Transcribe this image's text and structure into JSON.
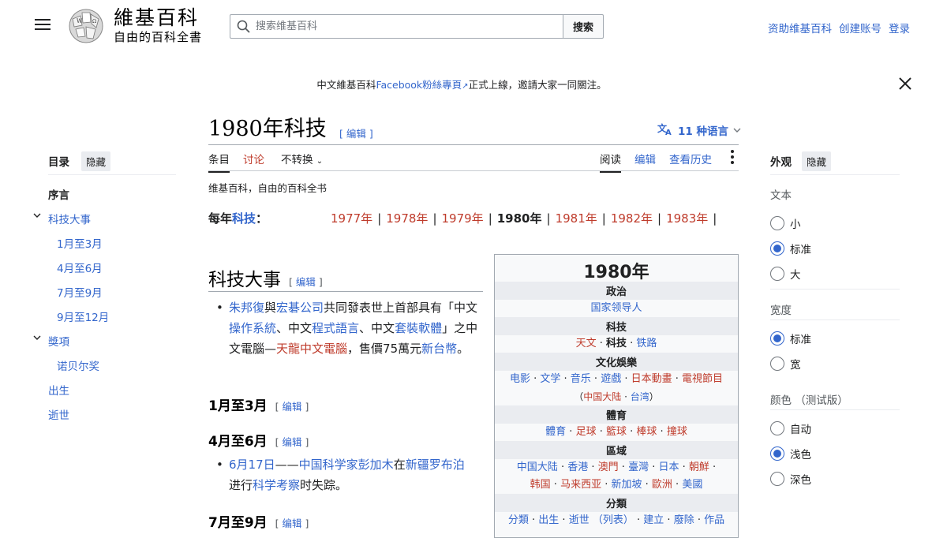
{
  "header": {
    "logo_title": "維基百科",
    "logo_tagline": "自由的百科全書",
    "search_placeholder": "搜索维基百科",
    "search_button": "搜索",
    "user_links": [
      "资助维基百科",
      "创建账号",
      "登录"
    ]
  },
  "banner": {
    "prefix": "中文維基百科",
    "link": "Facebook粉絲專頁",
    "suffix": "正式上線，邀請大家一同關注。"
  },
  "article": {
    "title": "1980年科技",
    "edit_label": "[ 编辑 ]",
    "languages": "11 种语言",
    "tabs_left": [
      "条目",
      "讨论",
      "不转换"
    ],
    "tabs_right": [
      "阅读",
      "编辑",
      "查看历史"
    ],
    "tagline": "维基百科，自由的百科全书",
    "year_label_prefix": "每年",
    "year_label_link": "科技",
    "year_label_suffix": "：",
    "years": [
      "1977年",
      "1978年",
      "1979年",
      "1980年",
      "1981年",
      "1982年",
      "1983年"
    ],
    "section1": {
      "heading": "科技大事",
      "bullet": {
        "p1": "朱邦復",
        "p2": "與",
        "p3": "宏碁公司",
        "p4": "共同發表世上首部具有「中文",
        "p5": "操作系統",
        "p6": "、中文",
        "p7": "程式語言",
        "p8": "、中文",
        "p9": "套裝軟體",
        "p10": "」之中文電腦—",
        "p11": "天龍中文電腦",
        "p12": "，售價75萬元",
        "p13": "新台幣",
        "p14": "。"
      }
    },
    "h3_jan": "1月至3月",
    "h3_apr": "4月至6月",
    "apr_bullet": {
      "p1": "6月17日",
      "p2": "——",
      "p3": "中国",
      "p4": "科学家",
      "p5": "彭加木",
      "p6": "在",
      "p7": "新疆",
      "p8": "罗布泊",
      "p9": "进行",
      "p10": "科学考察",
      "p11": "时失踪。"
    },
    "h3_jul": "7月至9月",
    "edit_small": "[ 编辑 ]"
  },
  "toc": {
    "title": "目录",
    "hide": "隐藏",
    "items": [
      "序言",
      "科技大事",
      "1月至3月",
      "4月至6月",
      "7月至9月",
      "9月至12月",
      "獎項",
      "诺贝尔奖",
      "出生",
      "逝世"
    ]
  },
  "infobox": {
    "title": "1980年",
    "politics_head": "政治",
    "politics_row": "国家领导人",
    "tech_head": "科技",
    "tech_row": [
      "天文",
      "科技",
      "铁路"
    ],
    "culture_head": "文化娛樂",
    "culture_row": [
      "电影",
      "文学",
      "音乐",
      "遊戲",
      "日本動畫",
      "電視節目"
    ],
    "culture_row2": [
      "（",
      "中国大陆",
      "台湾",
      "）"
    ],
    "sports_head": "體育",
    "sports_row": [
      "體育",
      "足球",
      "籃球",
      "棒球",
      "撞球"
    ],
    "region_head": "區域",
    "region_row1": [
      "中国大陆",
      "香港",
      "澳門",
      "臺灣",
      "日本",
      "朝鮮"
    ],
    "region_row2": [
      "韩国",
      "马来西亚",
      "新加坡",
      "歐洲",
      "美國"
    ],
    "category_head": "分類",
    "category_row": [
      "分類",
      "出生",
      "逝世",
      "（列表）",
      "建立",
      "廢除",
      "作品"
    ]
  },
  "appearance": {
    "title": "外观",
    "hide": "隐藏",
    "text_label": "文本",
    "text_options": [
      "小",
      "标准",
      "大"
    ],
    "text_selected": 1,
    "width_label": "宽度",
    "width_options": [
      "标准",
      "宽"
    ],
    "width_selected": 0,
    "color_label": "颜色 （测试版）",
    "color_options": [
      "自动",
      "浅色",
      "深色"
    ],
    "color_selected": 1
  }
}
